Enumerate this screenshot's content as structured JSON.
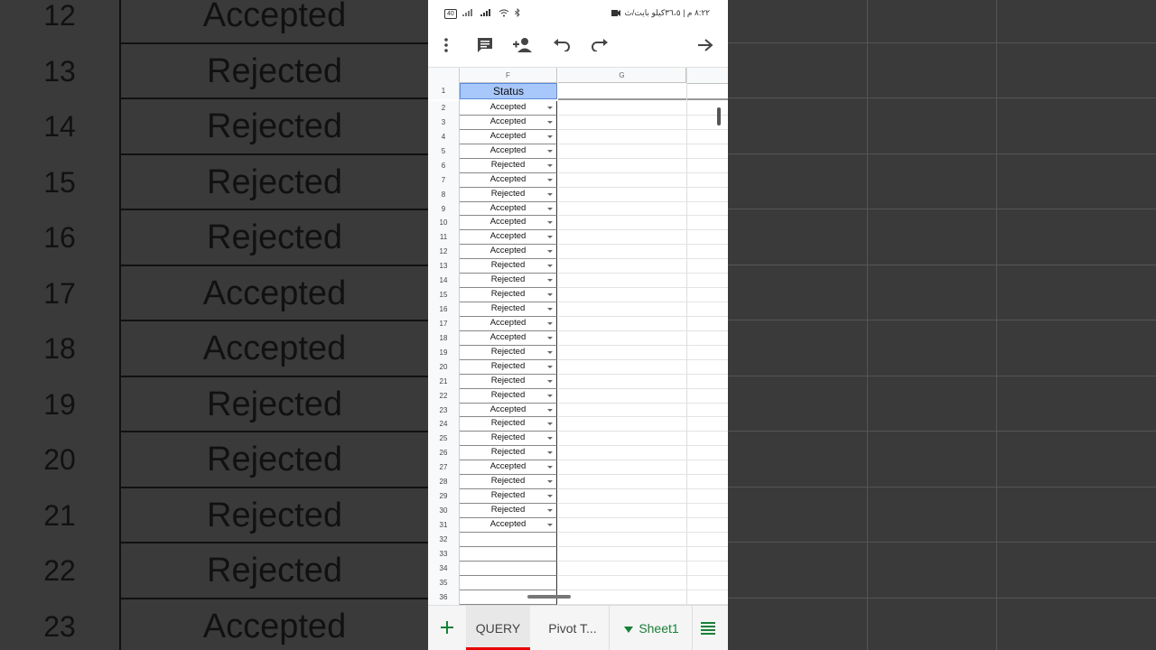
{
  "background": {
    "rows": [
      {
        "num": "12",
        "status": "Accepted"
      },
      {
        "num": "13",
        "status": "Rejected"
      },
      {
        "num": "14",
        "status": "Rejected"
      },
      {
        "num": "15",
        "status": "Rejected"
      },
      {
        "num": "16",
        "status": "Rejected"
      },
      {
        "num": "17",
        "status": "Accepted"
      },
      {
        "num": "18",
        "status": "Accepted"
      },
      {
        "num": "19",
        "status": "Rejected"
      },
      {
        "num": "20",
        "status": "Rejected"
      },
      {
        "num": "21",
        "status": "Rejected"
      },
      {
        "num": "22",
        "status": "Rejected"
      },
      {
        "num": "23",
        "status": "Accepted"
      }
    ]
  },
  "statusbar": {
    "battery": "40",
    "time_text": "٨:٢٢ م | ٣٦،٥كيلو بايت/ث"
  },
  "toolbar": {
    "more_icon": "more-vert-icon",
    "comment_icon": "comment-icon",
    "share_icon": "add-person-icon",
    "undo_icon": "undo-icon",
    "redo_icon": "redo-icon",
    "forward_icon": "arrow-right-icon"
  },
  "sheet": {
    "col_f": "F",
    "col_g": "G",
    "header_row_num": "1",
    "header_value": "Status",
    "rows": [
      {
        "num": "2",
        "status": "Accepted"
      },
      {
        "num": "3",
        "status": "Accepted"
      },
      {
        "num": "4",
        "status": "Accepted"
      },
      {
        "num": "5",
        "status": "Accepted"
      },
      {
        "num": "6",
        "status": "Rejected"
      },
      {
        "num": "7",
        "status": "Accepted"
      },
      {
        "num": "8",
        "status": "Rejected"
      },
      {
        "num": "9",
        "status": "Accepted"
      },
      {
        "num": "10",
        "status": "Accepted"
      },
      {
        "num": "11",
        "status": "Accepted"
      },
      {
        "num": "12",
        "status": "Accepted"
      },
      {
        "num": "13",
        "status": "Rejected"
      },
      {
        "num": "14",
        "status": "Rejected"
      },
      {
        "num": "15",
        "status": "Rejected"
      },
      {
        "num": "16",
        "status": "Rejected"
      },
      {
        "num": "17",
        "status": "Accepted"
      },
      {
        "num": "18",
        "status": "Accepted"
      },
      {
        "num": "19",
        "status": "Rejected"
      },
      {
        "num": "20",
        "status": "Rejected"
      },
      {
        "num": "21",
        "status": "Rejected"
      },
      {
        "num": "22",
        "status": "Rejected"
      },
      {
        "num": "23",
        "status": "Accepted"
      },
      {
        "num": "24",
        "status": "Rejected"
      },
      {
        "num": "25",
        "status": "Rejected"
      },
      {
        "num": "26",
        "status": "Rejected"
      },
      {
        "num": "27",
        "status": "Accepted"
      },
      {
        "num": "28",
        "status": "Rejected"
      },
      {
        "num": "29",
        "status": "Rejected"
      },
      {
        "num": "30",
        "status": "Rejected"
      },
      {
        "num": "31",
        "status": "Accepted"
      }
    ],
    "empty_rows": [
      "32",
      "33",
      "34",
      "35",
      "36"
    ]
  },
  "bottombar": {
    "add_icon": "plus-icon",
    "tabs": [
      {
        "label": "QUERY",
        "active": true
      },
      {
        "label": "Pivot T...",
        "active": false
      },
      {
        "label": "Sheet1",
        "active": false
      }
    ],
    "list_icon": "sheet-list-icon",
    "accent_color": "#188038",
    "active_underline_color": "#e60000"
  }
}
